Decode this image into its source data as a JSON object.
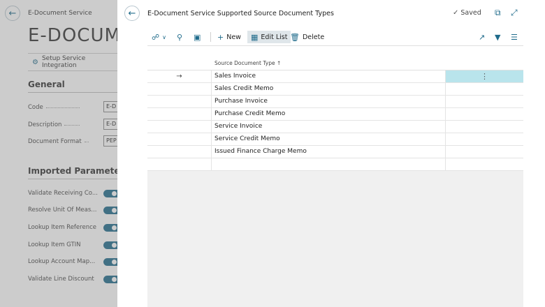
{
  "background": {
    "caption": "E-Document Service",
    "title": "E-DOCUME",
    "action": "Setup Service Integration",
    "sections": {
      "general": "General",
      "imported": "Imported Parameters"
    },
    "general_fields": [
      {
        "label": "Code",
        "value": "E-D"
      },
      {
        "label": "Description",
        "value": "E-D"
      },
      {
        "label": "Document Format",
        "value": "PEP"
      }
    ],
    "imported_fields": [
      {
        "label": "Validate Receiving Co..."
      },
      {
        "label": "Resolve Unit Of Meas..."
      },
      {
        "label": "Lookup Item Reference"
      },
      {
        "label": "Lookup Item GTIN"
      },
      {
        "label": "Lookup Account Map..."
      },
      {
        "label": "Validate Line Discount"
      }
    ]
  },
  "dialog": {
    "title": "E-Document Service Supported Source Document Types",
    "saved": "Saved",
    "toolbar": {
      "new": "New",
      "edit_list": "Edit List",
      "delete": "Delete"
    },
    "column_header": "Source Document Type ↑",
    "rows": [
      {
        "marker": "→",
        "value": "Sales Invoice",
        "menu": "⋮"
      },
      {
        "marker": "",
        "value": "Sales Credit Memo",
        "menu": ""
      },
      {
        "marker": "",
        "value": "Purchase Invoice",
        "menu": ""
      },
      {
        "marker": "",
        "value": "Purchase Credit Memo",
        "menu": ""
      },
      {
        "marker": "",
        "value": "Service Invoice",
        "menu": ""
      },
      {
        "marker": "",
        "value": "Service Credit Memo",
        "menu": ""
      },
      {
        "marker": "",
        "value": "Issued Finance Charge Memo",
        "menu": ""
      },
      {
        "marker": "",
        "value": "",
        "menu": ""
      }
    ]
  },
  "colors": {
    "accent": "#1f6b8b",
    "selection": "#b9e4ec"
  }
}
